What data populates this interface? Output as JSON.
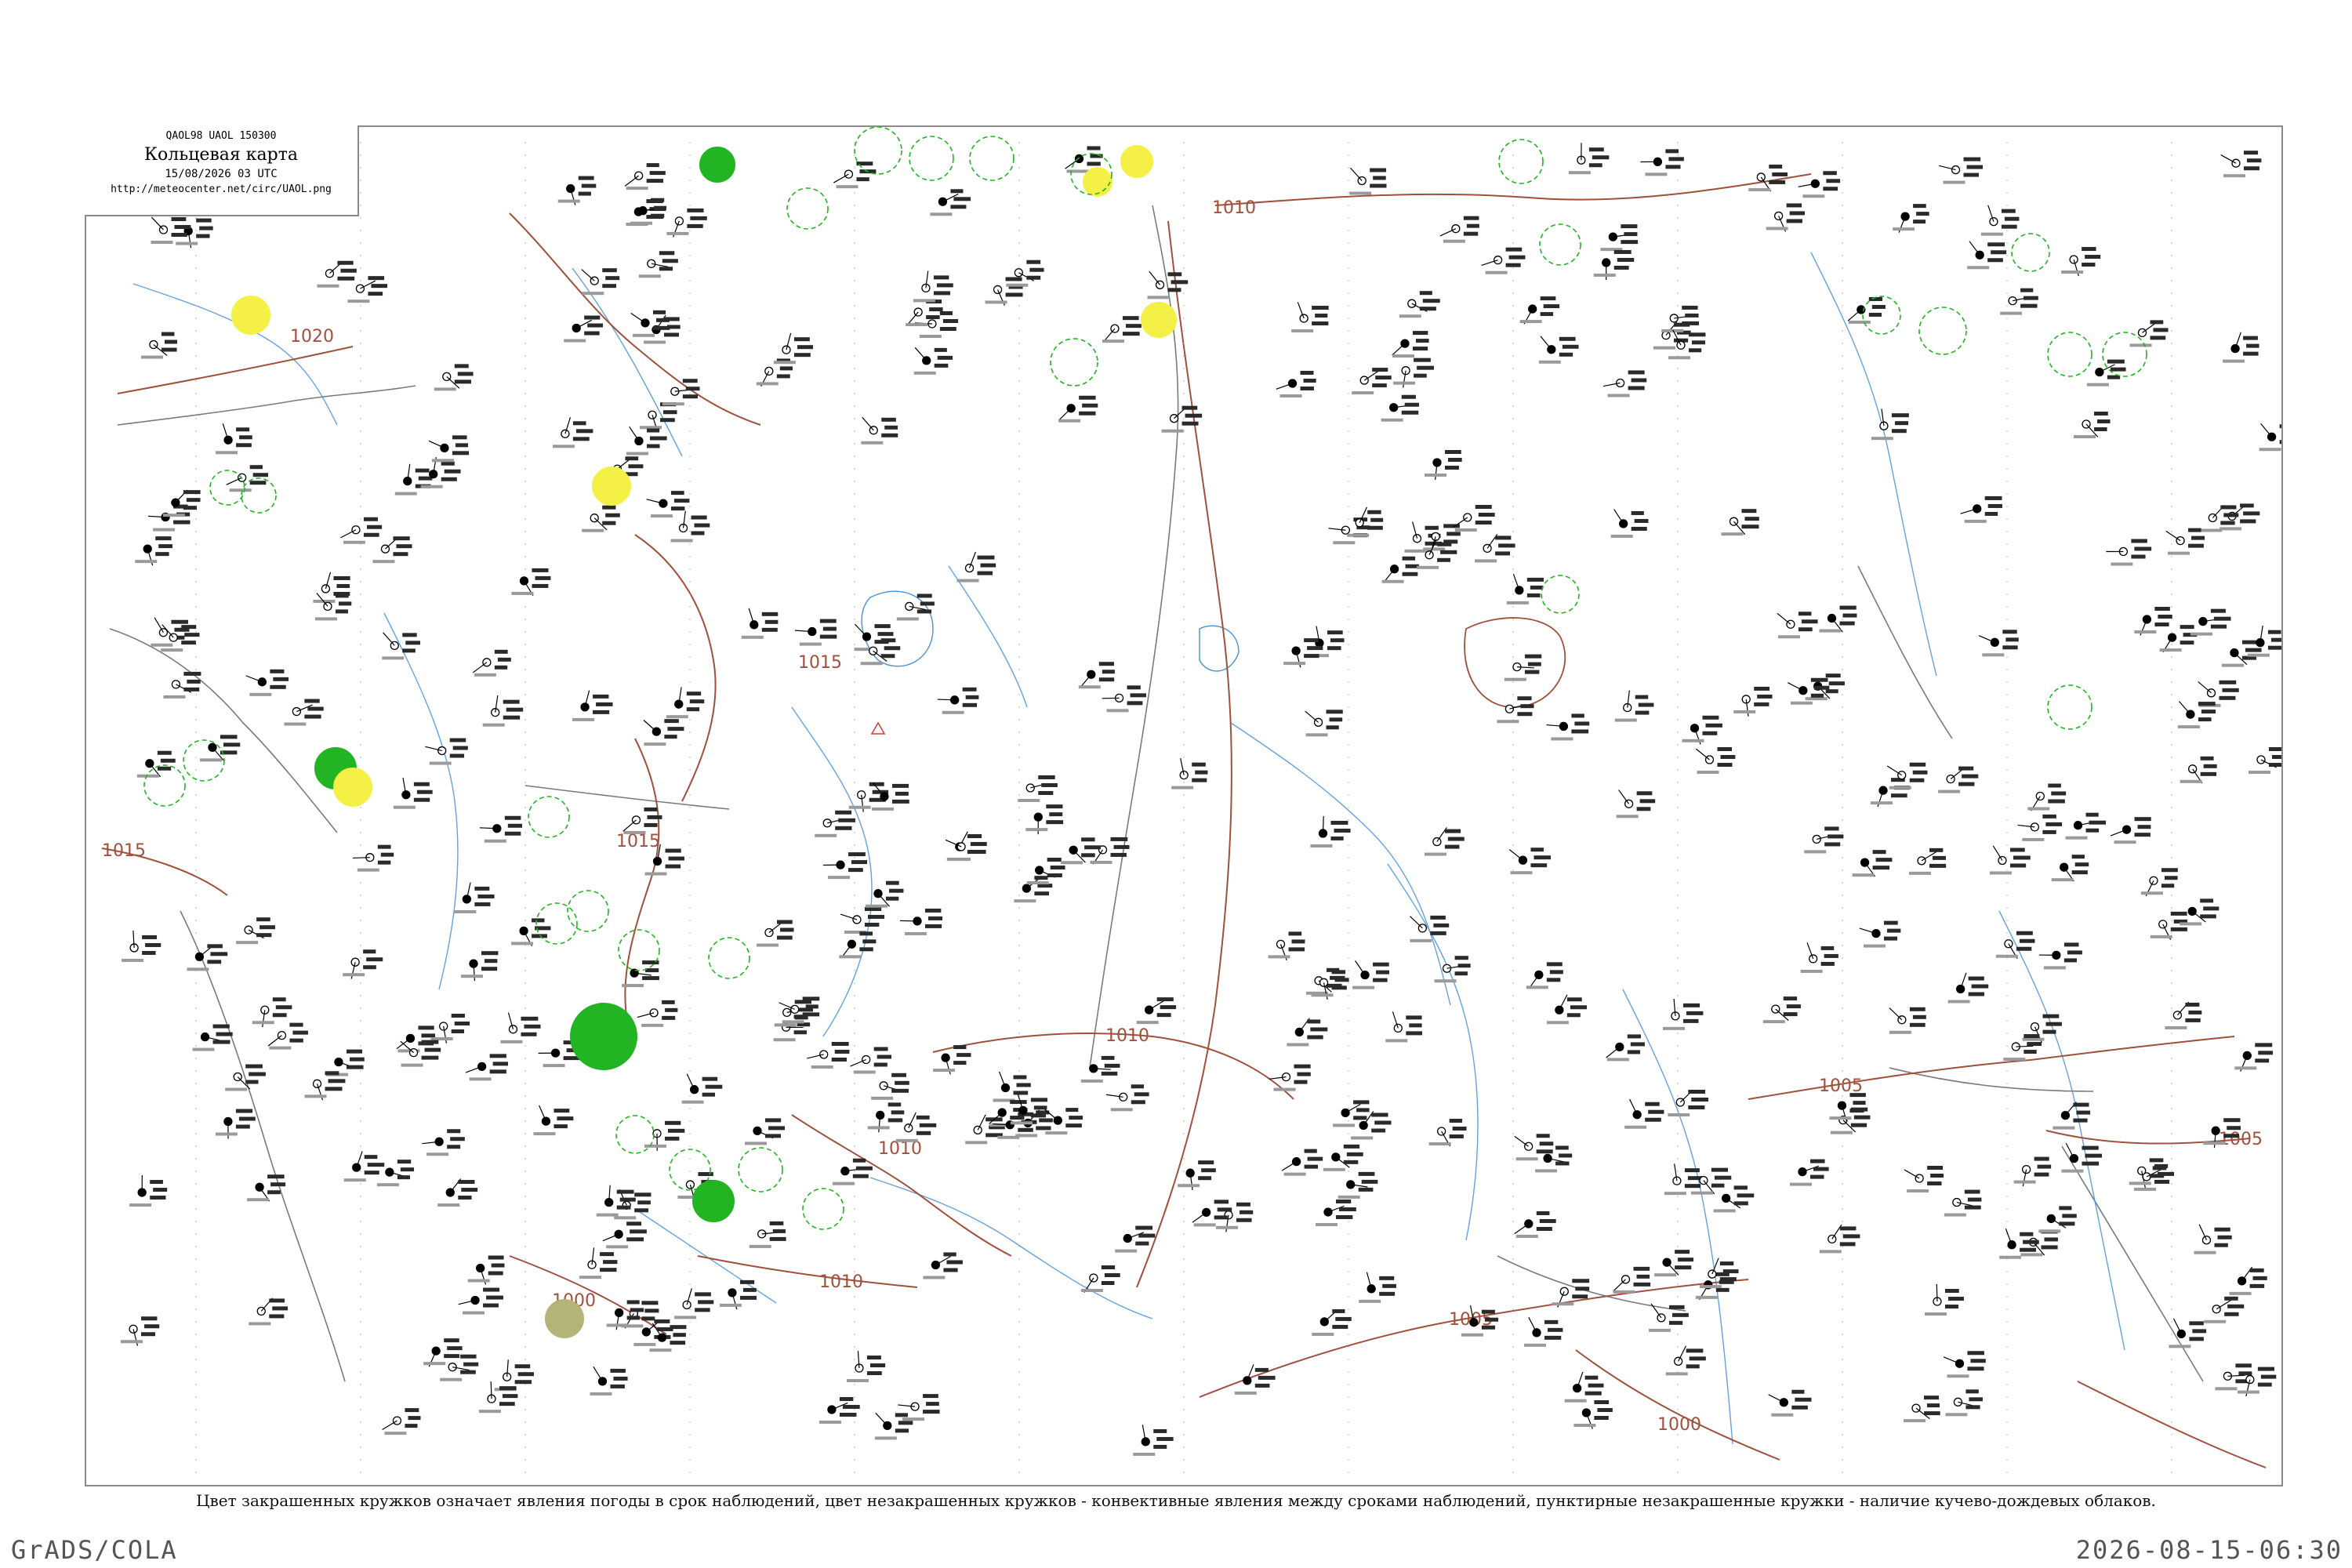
{
  "header": {
    "code": "QAOL98  UAOL  150300",
    "title": "Кольцевая карта",
    "datetime": "15/08/2026 03 UTC",
    "url": "http://meteocenter.net/circ/UAOL.png"
  },
  "caption": "Цвет закрашенных кружков означает явления погоды в срок наблюдений, цвет незакрашенных кружков - конвективные явления между сроками наблюдений, пунктирные незакрашенные кружки - наличие кучево-дождевых облаков.",
  "footer": {
    "left": "GrADS/COLA",
    "right": "2026-08-15-06:30"
  },
  "isobars": [
    "1020",
    "1015",
    "1015",
    "1015",
    "1010",
    "1010",
    "1010",
    "1010",
    "1005",
    "1005",
    "1005",
    "1000",
    "1000"
  ],
  "colors": {
    "isobar": "#a0503c",
    "river": "#4a90d9",
    "border": "#6a6a6a",
    "rain_fill": "#22b422",
    "haze_fill": "#f5f046",
    "dust_fill": "#b4b478",
    "cb_circle": "#22b422"
  }
}
